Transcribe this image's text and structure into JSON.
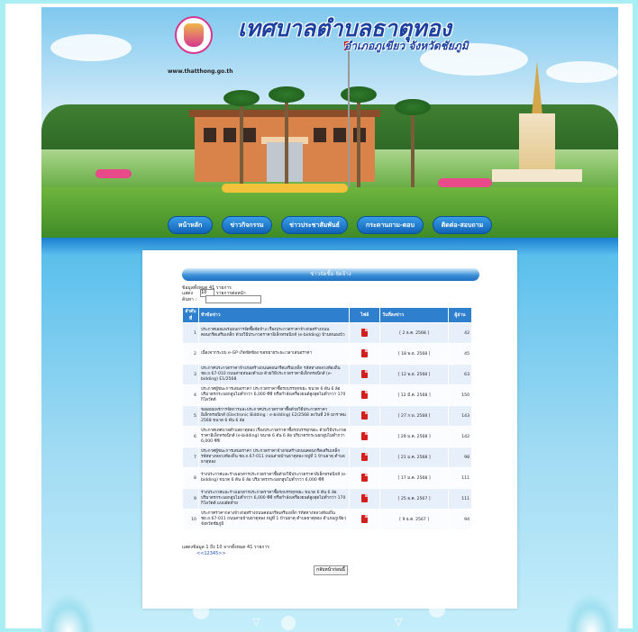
{
  "header": {
    "site_title": "เทศบาลตำบลธาตุทอง",
    "site_subtitle": "อำเภอภูเขียว จังหวัดชัยภูมิ",
    "site_url": "www.thatthong.go.th"
  },
  "nav": {
    "items": [
      "หน้าหลัก",
      "ข่าวกิจกรรม",
      "ข่าวประชาสัมพันธ์",
      "กระดานถาม-ตอบ",
      "ติดต่อ-สอบถาม"
    ]
  },
  "panel": {
    "header": "ข่าวจัดซื้อ-จัดจ้าง",
    "total_label": "ข้อมูลทั้งหมด 41 รายการ",
    "show_prefix": "แสดง",
    "show_value": "10",
    "show_suffix": "รายการต่อหน้า",
    "search_label": "ค้นหา :"
  },
  "table": {
    "headers": [
      "ลำดับที่",
      "หัวข้อข่าว",
      "ไฟล์",
      "วันที่ลงข่าว",
      "ผู้อ่าน"
    ],
    "rows": [
      {
        "no": "1",
        "title": "ประกาศเผยแพร่แผนการจัดซื้อจัดจ้าง เรื่องประกวดราคาจ้างก่อสร้างถนนคอนกรีตเสริมเหล็ก ด้วยวิธีประกวดราคาอิเล็กทรอนิกส์ (e-bidding) บ้านหนองบัว",
        "date": "[ 2 ธ.ค. 2568 ]",
        "views": "42"
      },
      {
        "no": "2",
        "title": "เนื่องจากระบบ e-GP เกิดขัดข้อง ขอขยายระยะเวลาเสนอราคา",
        "date": "[ 18 พ.ย. 2568 ]",
        "views": "45"
      },
      {
        "no": "3",
        "title": "ประกาศประกวดราคาจ้างก่อสร้างถนนคอนกรีตเสริมเหล็ก รหัสทางหลวงท้องถิ่น ชย.ถ.67-010 ถนนสายหนองตำแย ด้วยวิธีประกวดราคาอิเล็กทรอนิกส์ (e-bidding) E1/2568",
        "date": "[ 12 พ.ย. 2568 ]",
        "views": "63"
      },
      {
        "no": "4",
        "title": "ประกาศผู้ชนะการเสนอราคา ประกวดราคาซื้อรถบรรทุกขยะ ขนาด 6 ตัน 6 ล้อ ปริมาตรกระบอกสูบไม่ต่ำกว่า 6,000 ซีซี หรือกำลังเครื่องยนต์สูงสุดไม่ต่ำกว่า 170 กิโลวัตต์",
        "date": "[ 12 มี.ค. 2568 ]",
        "views": "150"
      },
      {
        "no": "5",
        "title": "ขอเผยแพร่การจัดการและประกาศประกวดราคาซื้อด้วยวิธีประกวดราคาอิเล็กทรอนิกส์ (Electronic Bidding : e-bidding) E2/2568 ลงวันที่ 29 มกราคม 2568 ขนาด 6 ตัน 6 ล้อ",
        "date": "[ 27 ก.พ. 2568 ]",
        "views": "143"
      },
      {
        "no": "6",
        "title": "ประกาศเทศบาลตำบลธาตุทอง เรื่องประกวดราคาซื้อรถบรรทุกขยะ ด้วยวิธีประกวดราคาอิเล็กทรอนิกส์ (e-bidding) ขนาด 6 ตัน 6 ล้อ ปริมาตรกระบอกสูบไม่ต่ำกว่า 6,000 ซีซี",
        "date": "[ 29 ม.ค. 2568 ]",
        "views": "142"
      },
      {
        "no": "7",
        "title": "ประกาศผู้ชนะการเสนอราคา ประกวดราคาจ้างก่อสร้างถนนคอนกรีตเสริมเหล็ก รหัสทางหลวงท้องถิ่น ชย.ถ.67-011 ถนนสายบ้านธาตุทอง หมู่ที่ 1 บ้านธาตุ ตำบลธาตุทอง",
        "date": "[ 21 ม.ค. 2568 ]",
        "views": "98"
      },
      {
        "no": "8",
        "title": "ร่างประกาศและร่างเอกสารประกวดราคาซื้อด้วยวิธีประกวดราคาอิเล็กทรอนิกส์ (e-bidding) ขนาด 6 ตัน 6 ล้อ ปริมาตรกระบอกสูบไม่ต่ำกว่า 6,000 ซีซี",
        "date": "[ 17 ม.ค. 2568 ]",
        "views": "111"
      },
      {
        "no": "9",
        "title": "ร่างประกาศและร่างเอกสารประกวดราคาซื้อรถบรรทุกขยะ ขนาด 6 ตัน 6 ล้อ ปริมาตรกระบอกสูบไม่ต่ำกว่า 6,000 ซีซี หรือกำลังเครื่องยนต์สูงสุดไม่ต่ำกว่า 170 กิโลวัตต์ แบบอัดท้าย",
        "date": "[ 25 ธ.ค. 2567 ]",
        "views": "111"
      },
      {
        "no": "10",
        "title": "ประกาศราคากลางจ้างก่อสร้างถนนคอนกรีตเสริมเหล็ก รหัสทางหลวงท้องถิ่น ชย.ถ.67-011 ถนนสายบ้านธาตุทอง หมู่ที่ 1 บ้านธาตุ ตำบลธาตุทอง อำเภอภูเขียว จังหวัดชัยภูมิ",
        "date": "[ 9 ธ.ค. 2567 ]",
        "views": "94"
      }
    ]
  },
  "footer": {
    "summary": "แสดงข้อมูล 1 ถึง 10 จากทั้งหมด 41 รายการ",
    "pager": "<<12345>>",
    "back_label": "กลับหน้าก่อนนี้"
  },
  "colors": {
    "background": "#a9eef2",
    "table_header": "#2f7fcf",
    "nav_button": "#1162b6",
    "title_blue": "#1d3f9e"
  }
}
